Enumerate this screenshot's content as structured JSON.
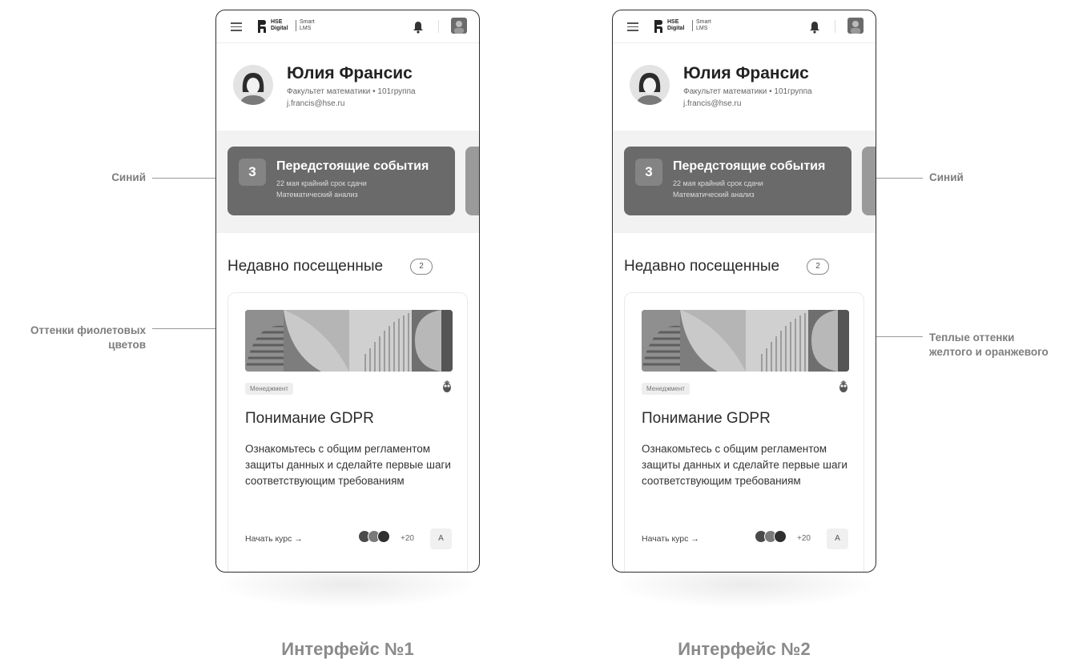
{
  "interfaces": [
    {
      "caption": "Интерфейс №1",
      "header": {
        "logo_line1": "HSE",
        "logo_line2": "Digital",
        "product_line1": "Smart",
        "product_line2": "LMS"
      },
      "profile": {
        "name": "Юлия Франсис",
        "faculty_group": "Факультет математики  •  101группа",
        "email": "j.francis@hse.ru"
      },
      "event": {
        "count": "3",
        "title": "Передстоящие события",
        "line1": "22 мая крайний срок сдачи",
        "line2": "Математический анализ"
      },
      "recent": {
        "title": "Недавно посещенные",
        "count": "2"
      },
      "course": {
        "tag": "Менеджмент",
        "title": "Понимание GDPR",
        "description": "Ознакомьтесь с общим регламентом защиты данных и сделайте первые шаги соответствующим требованиям",
        "start_label": "Начать курс  →",
        "participants_more": "+20",
        "action_label": "A"
      }
    },
    {
      "caption": "Интерфейс №2",
      "header": {
        "logo_line1": "HSE",
        "logo_line2": "Digital",
        "product_line1": "Smart",
        "product_line2": "LMS"
      },
      "profile": {
        "name": "Юлия Франсис",
        "faculty_group": "Факультет математики  •  101группа",
        "email": "j.francis@hse.ru"
      },
      "event": {
        "count": "3",
        "title": "Передстоящие события",
        "line1": "22 мая крайний срок сдачи",
        "line2": "Математический анализ"
      },
      "recent": {
        "title": "Недавно посещенные",
        "count": "2"
      },
      "course": {
        "tag": "Менеджмент",
        "title": "Понимание GDPR",
        "description": "Ознакомьтесь с общим регламентом защиты данных и сделайте первые шаги соответствующим требованиям",
        "start_label": "Начать курс  →",
        "participants_more": "+20",
        "action_label": "A"
      }
    }
  ],
  "annotations": {
    "left_event": "Синий",
    "left_banner_line1": "Оттенки фиолетовых",
    "left_banner_line2": "цветов",
    "right_event": "Синий",
    "right_banner_line1": "Теплые оттенки",
    "right_banner_line2": "желтого и оранжевого"
  },
  "icons": {
    "menu": "hamburger-menu-icon",
    "logo": "hse-logo-icon",
    "bell": "bell-icon",
    "user": "user-avatar-icon",
    "course": "course-mascot-icon",
    "arrow": "arrow-right-icon"
  }
}
